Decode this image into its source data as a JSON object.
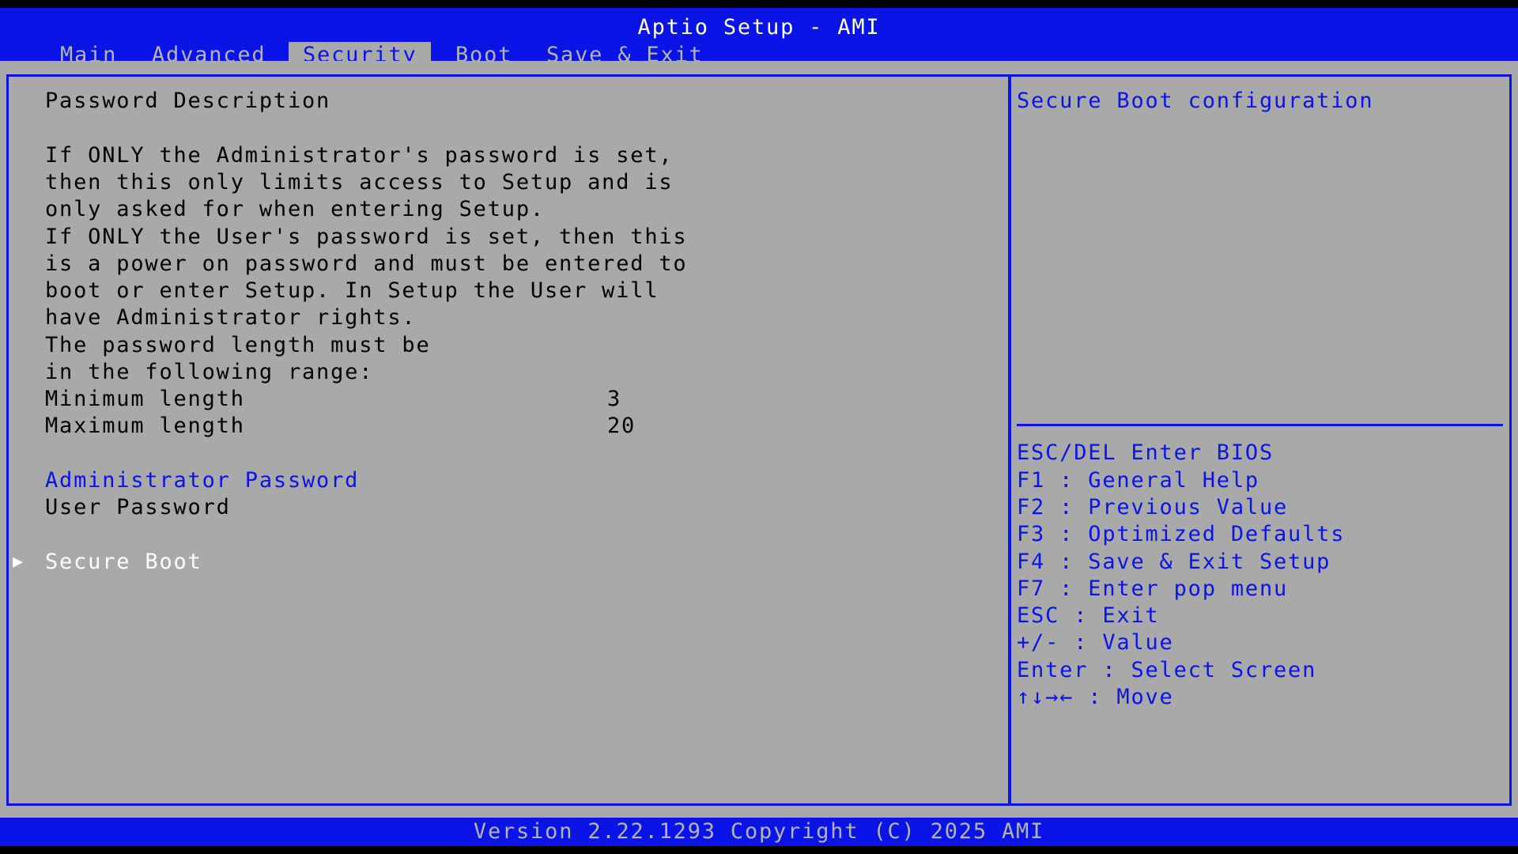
{
  "app": {
    "title": "Aptio Setup - AMI",
    "version": "Version 2.22.1293 Copyright (C) 2025 AMI"
  },
  "tabs": [
    {
      "label": "Main",
      "active": false
    },
    {
      "label": "Advanced",
      "active": false
    },
    {
      "label": "Security",
      "active": true
    },
    {
      "label": "Boot",
      "active": false
    },
    {
      "label": "Save & Exit",
      "active": false
    }
  ],
  "main": {
    "heading": "Password Description",
    "description": [
      "If ONLY the Administrator's password is set,",
      "then this only limits access to Setup and is",
      "only asked for when entering Setup.",
      "If ONLY the User's password is set, then this",
      "is a power on password and must be entered to",
      "boot or enter Setup. In Setup the User will",
      "have Administrator rights.",
      "The password length must be",
      "in the following range:"
    ],
    "min_label": "Minimum length",
    "min_value": "3",
    "max_label": "Maximum length",
    "max_value": "20",
    "admin_password": "Administrator Password",
    "user_password": "User Password",
    "secure_boot": "Secure Boot",
    "selected_arrow": "▶"
  },
  "help": {
    "text": "Secure Boot configuration",
    "keys": [
      "ESC/DEL Enter BIOS",
      "F1 : General Help",
      "F2 : Previous Value",
      "F3 : Optimized Defaults",
      "F4 : Save & Exit Setup",
      "F7 : Enter pop menu",
      "ESC : Exit",
      "+/- : Value",
      "Enter : Select Screen",
      "↑↓→← : Move"
    ]
  },
  "colors": {
    "bios_blue": "#0a14e6",
    "panel_gray": "#a9a9a9",
    "inactive_text": "#b4b4b4"
  }
}
